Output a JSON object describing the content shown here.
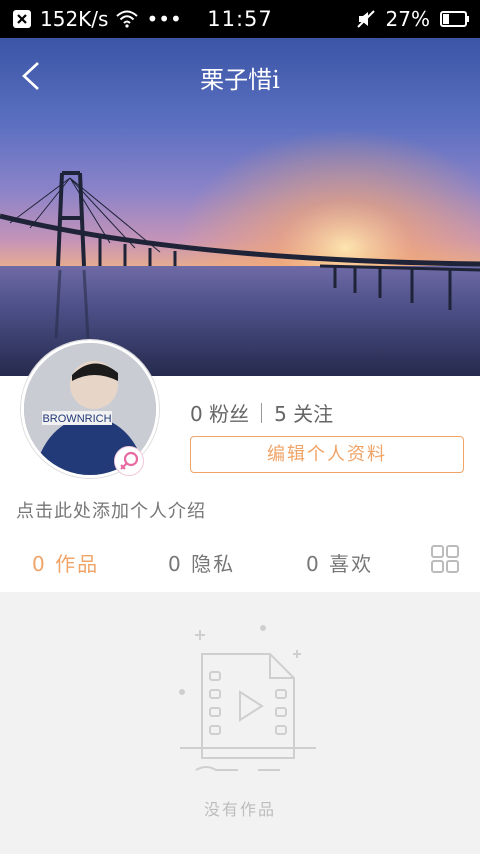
{
  "status_bar": {
    "network_speed": "152K/s",
    "more": "•••",
    "time": "11:57",
    "battery_percent": "27%"
  },
  "header": {
    "title": "栗子惜i"
  },
  "profile": {
    "avatar_text": "BROWNRICH",
    "followers": "0 粉丝",
    "following": "5 关注",
    "edit_button_label": "编辑个人资料",
    "intro_placeholder": "点击此处添加个人介绍"
  },
  "tabs": [
    {
      "label": "0 作品",
      "active": true
    },
    {
      "label": "0 隐私",
      "active": false
    },
    {
      "label": "0 喜欢",
      "active": false
    }
  ],
  "empty_state": {
    "text": "没有作品"
  },
  "colors": {
    "accent": "#f0a468",
    "background_gray": "#f2f2f2",
    "gender_pink": "#e76aa0"
  }
}
